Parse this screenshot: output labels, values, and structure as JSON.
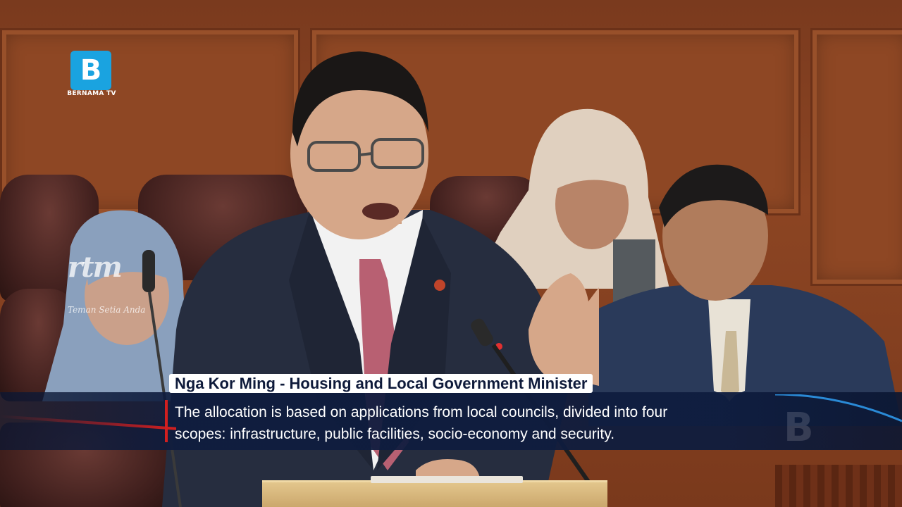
{
  "broadcaster": {
    "logo_letter": "B",
    "logo_text": "BERNAMA TV",
    "watermark": "rtm",
    "watermark_tagline": "Teman Setia Anda"
  },
  "lower_third": {
    "speaker": "Nga Kor Ming - Housing and Local Government Minister",
    "caption_line1": "The allocation is based on applications from local councils, divided into four",
    "caption_line2": "scopes: infrastructure, public facilities, socio-economy and security."
  },
  "colors": {
    "bernama_blue": "#1aa3e0",
    "caption_bg": "#0e1c3e",
    "accent_red": "#d21f1f",
    "tie_pink": "#b86072",
    "suit_navy": "#262d3f"
  }
}
